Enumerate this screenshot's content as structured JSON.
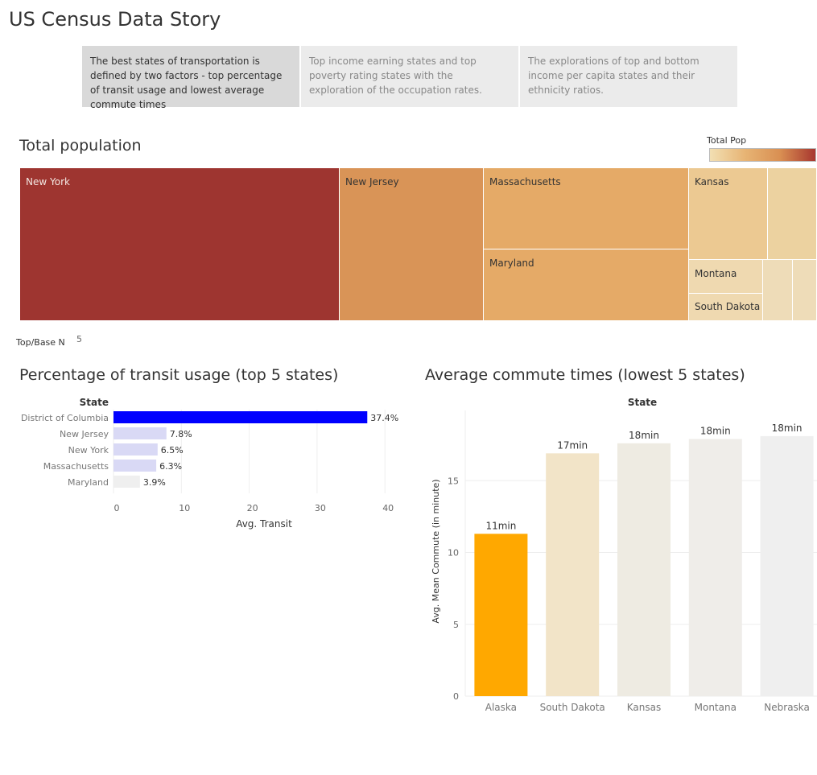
{
  "story": {
    "title": "US Census Data Story",
    "points": [
      {
        "text": "The best states of transportation is defined by two factors - top percentage of transit usage and lowest average commute times",
        "active": true
      },
      {
        "text": "Top income earning states and top poverty rating states with the exploration of the occupation rates.",
        "active": false
      },
      {
        "text": "The explorations of top and bottom income per capita states and their ethnicity ratios.",
        "active": false
      }
    ]
  },
  "treemap": {
    "title": "Total population",
    "legend_title": "Total Pop",
    "labels": [
      "New York",
      "New Jersey",
      "Massachusetts",
      "Maryland",
      "Kansas",
      "Montana",
      "South Dakota"
    ],
    "colors": {
      "new_york": "#9e3530",
      "new_jersey": "#d99457",
      "massachusetts": "#e5aa67",
      "maryland": "#e5aa67",
      "kansas": "#ecc992",
      "kansas_neighbor": "#ecd2a0",
      "montana": "#efd9b0",
      "south_dakota": "#efd9b0",
      "small": "#eedcb8"
    }
  },
  "parameter": {
    "label": "Top/Base N",
    "value": "5"
  },
  "transit": {
    "title": "Percentage of transit usage (top 5 states)",
    "header": "State",
    "xlabel": "Avg. Transit"
  },
  "commute": {
    "title": "Average commute times (lowest 5 states)",
    "header": "State",
    "ylabel": "Avg. Mean Commute (in minute)"
  },
  "chart_data": [
    {
      "type": "bar",
      "orientation": "horizontal",
      "title": "Percentage of transit usage (top 5 states)",
      "categories": [
        "District of Columbia",
        "New Jersey",
        "New York",
        "Massachusetts",
        "Maryland"
      ],
      "values": [
        37.4,
        7.8,
        6.5,
        6.3,
        3.9
      ],
      "data_labels": [
        "37.4%",
        "7.8%",
        "6.5%",
        "6.3%",
        "3.9%"
      ],
      "colors": [
        "#0000ff",
        "#d9d9f5",
        "#d9d9f5",
        "#d9d9f5",
        "#efefef"
      ],
      "xlabel": "Avg. Transit",
      "ylabel": "State",
      "xlim": [
        0,
        45
      ],
      "xticks": [
        0,
        10,
        20,
        30,
        40
      ],
      "grid": true
    },
    {
      "type": "bar",
      "orientation": "vertical",
      "title": "Average commute times (lowest 5 states)",
      "categories": [
        "Alaska",
        "South Dakota",
        "Kansas",
        "Montana",
        "Nebraska"
      ],
      "values": [
        11.3,
        16.9,
        17.6,
        17.9,
        18.1
      ],
      "data_labels": [
        "11min",
        "17min",
        "18min",
        "18min",
        "18min"
      ],
      "colors": [
        "#ffa800",
        "#f2e4c8",
        "#eeebe2",
        "#efede9",
        "#efefef"
      ],
      "xlabel": "State",
      "ylabel": "Avg. Mean Commute (in minute)",
      "ylim": [
        0,
        20
      ],
      "yticks": [
        0,
        5,
        10,
        15
      ],
      "grid": true
    }
  ]
}
